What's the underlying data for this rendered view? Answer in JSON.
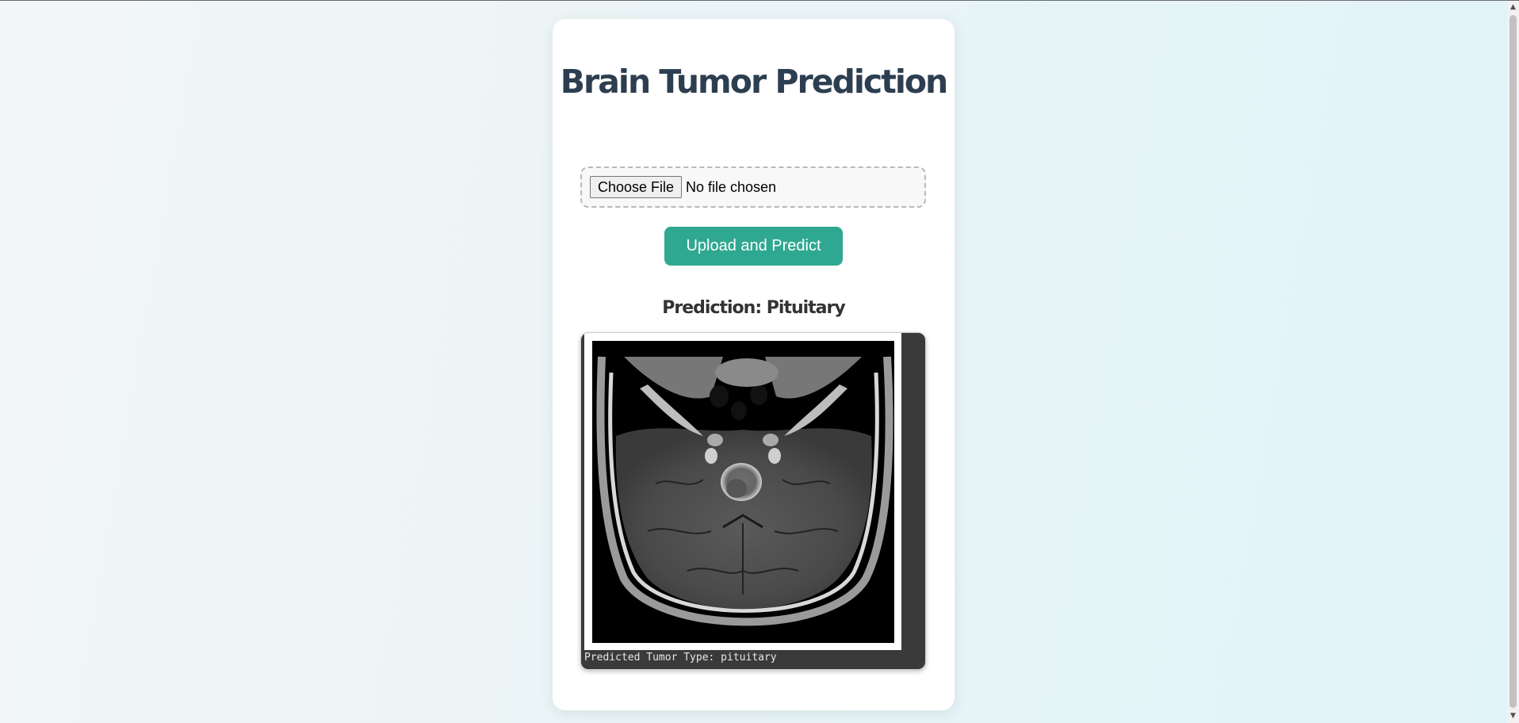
{
  "page": {
    "title": "Brain Tumor Prediction"
  },
  "upload": {
    "choose_label": "Choose File",
    "file_status": "No file chosen",
    "submit_label": "Upload and Predict"
  },
  "result": {
    "prediction_text": "Prediction: Pituitary",
    "caption": "Predicted Tumor Type: pituitary"
  },
  "colors": {
    "title": "#2c3e50",
    "accent_button": "#2fa891",
    "result_frame": "#3a3a3a"
  },
  "icons": {
    "scroll_up": "arrow-up-icon",
    "scroll_down": "arrow-down-icon"
  }
}
